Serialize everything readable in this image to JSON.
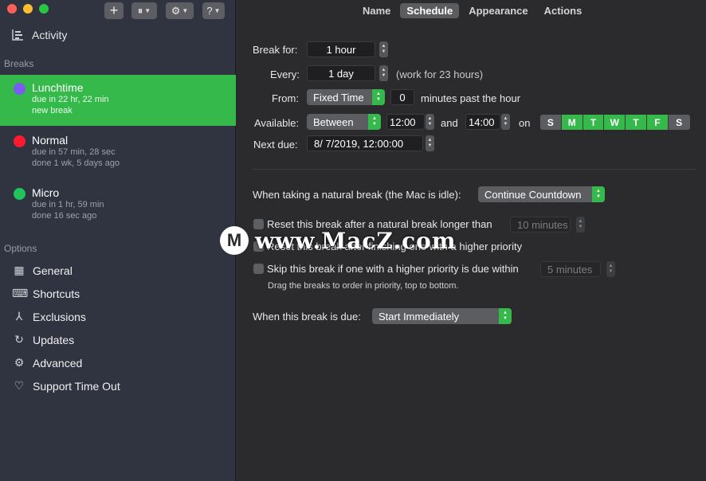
{
  "toolbar": {
    "add": "+",
    "pause": "⏸",
    "settings": "⚙",
    "help": "?",
    "chevron": "⌄"
  },
  "sidebar": {
    "activity": {
      "label": "Activity",
      "icon": "activity-chart-icon"
    },
    "breaks_heading": "Breaks",
    "breaks": [
      {
        "name": "Lunchtime",
        "line1": "due in 22 hr, 22 min",
        "line2": "new break",
        "color": "#7b5cf0",
        "selected": true
      },
      {
        "name": "Normal",
        "line1": "due in 57 min, 28 sec",
        "line2": "done 1 wk, 5 days ago",
        "color": "#ff1a2e",
        "selected": false
      },
      {
        "name": "Micro",
        "line1": "due in 1 hr, 59 min",
        "line2": "done 16 sec ago",
        "color": "#1fc55a",
        "selected": false
      }
    ],
    "options_heading": "Options",
    "options": [
      {
        "label": "General",
        "icon": "general-icon"
      },
      {
        "label": "Shortcuts",
        "icon": "shortcuts-icon"
      },
      {
        "label": "Exclusions",
        "icon": "exclusions-icon"
      },
      {
        "label": "Updates",
        "icon": "updates-icon"
      },
      {
        "label": "Advanced",
        "icon": "advanced-icon"
      },
      {
        "label": "Support Time Out",
        "icon": "heart-icon"
      }
    ]
  },
  "tabs": [
    "Name",
    "Schedule",
    "Appearance",
    "Actions"
  ],
  "active_tab": "Schedule",
  "schedule": {
    "break_for_label": "Break for:",
    "break_for_value": "1 hour",
    "every_label": "Every:",
    "every_value": "1 day",
    "every_note": "(work for 23 hours)",
    "from_label": "From:",
    "from_select": "Fixed Time",
    "from_minutes": "0",
    "from_note": "minutes past the hour",
    "available_label": "Available:",
    "available_select": "Between",
    "available_start": "12:00",
    "available_and": "and",
    "available_end": "14:00",
    "available_on": "on",
    "days": [
      {
        "letter": "S",
        "on": false
      },
      {
        "letter": "M",
        "on": true
      },
      {
        "letter": "T",
        "on": true
      },
      {
        "letter": "W",
        "on": true
      },
      {
        "letter": "T",
        "on": true
      },
      {
        "letter": "F",
        "on": true
      },
      {
        "letter": "S",
        "on": false
      }
    ],
    "next_due_label": "Next due:",
    "next_due_value": "8/  7/2019, 12:00:00",
    "natural_label": "When taking a natural break (the Mac is idle):",
    "natural_select": "Continue Countdown",
    "reset_label": "Reset this break after a natural break longer than",
    "reset_value": "10 minutes",
    "reset_higher_label": "Reset this break after finishing one with a higher priority",
    "skip_label": "Skip this break if one with a higher priority is due within",
    "skip_value": "5 minutes",
    "drag_hint": "Drag the breaks to order in priority, top to bottom.",
    "due_label": "When this break is due:",
    "due_select": "Start Immediately"
  },
  "watermark": {
    "logo": "M",
    "text": "www.MacZ.com"
  },
  "colors": {
    "accent": "#34b94a",
    "sidebar": "#303441",
    "pane": "#2b2b2d"
  }
}
